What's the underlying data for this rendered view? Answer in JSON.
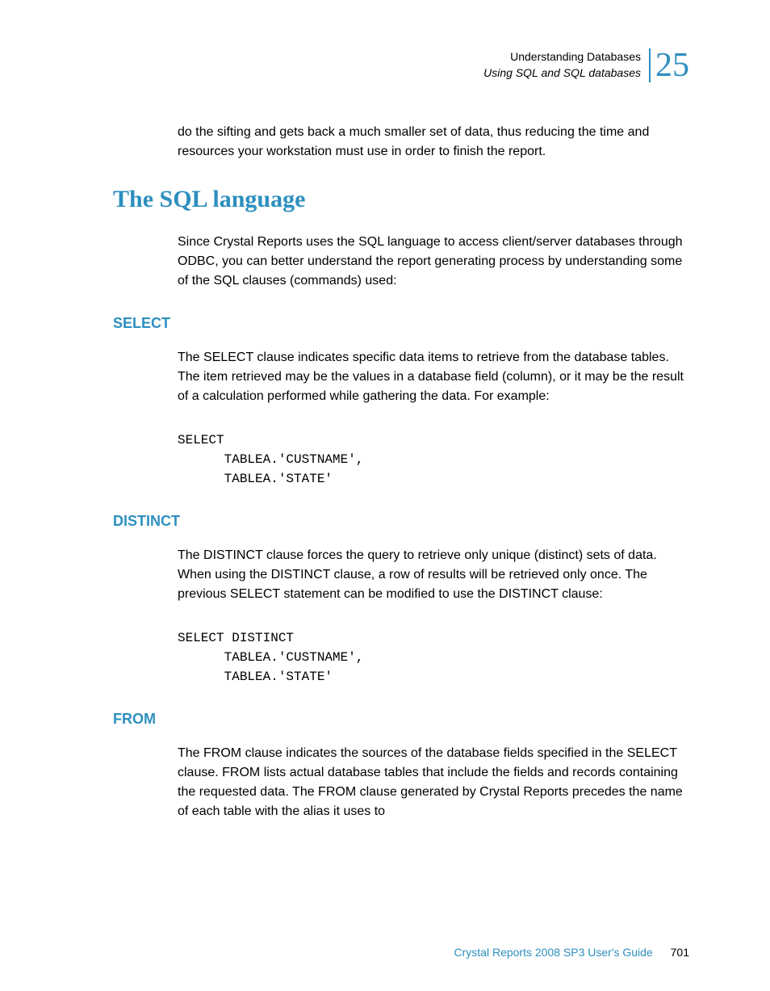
{
  "header": {
    "line1": "Understanding Databases",
    "line2": "Using SQL and SQL databases",
    "chapter": "25"
  },
  "intro_continuation": "do the sifting and gets back a much smaller set of data, thus reducing the time and resources your workstation must use in order to finish the report.",
  "main_heading": "The SQL language",
  "main_para": "Since Crystal Reports uses the SQL language to access client/server databases through ODBC, you can better understand the report generating process by understanding some of the SQL clauses (commands) used:",
  "sections": {
    "select": {
      "title": "SELECT",
      "para": "The SELECT clause indicates specific data items to retrieve from the database tables. The item retrieved may be the values in a database field (column), or it may be the result of a calculation performed while gathering the data. For example:",
      "code": "SELECT\n      TABLEA.'CUSTNAME',\n      TABLEA.'STATE'"
    },
    "distinct": {
      "title": "DISTINCT",
      "para": "The DISTINCT clause forces the query to retrieve only unique (distinct) sets of data. When using the DISTINCT clause, a row of results will be retrieved only once. The previous SELECT statement can be modified to use the DISTINCT clause:",
      "code": "SELECT DISTINCT\n      TABLEA.'CUSTNAME',\n      TABLEA.'STATE'"
    },
    "from": {
      "title": "FROM",
      "para": "The FROM clause indicates the sources of the database fields specified in the SELECT clause. FROM lists actual database tables that include the fields and records containing the requested data. The FROM clause generated by Crystal Reports precedes the name of each table with the alias it uses to"
    }
  },
  "footer": {
    "guide": "Crystal Reports 2008 SP3 User's Guide",
    "page": "701"
  }
}
